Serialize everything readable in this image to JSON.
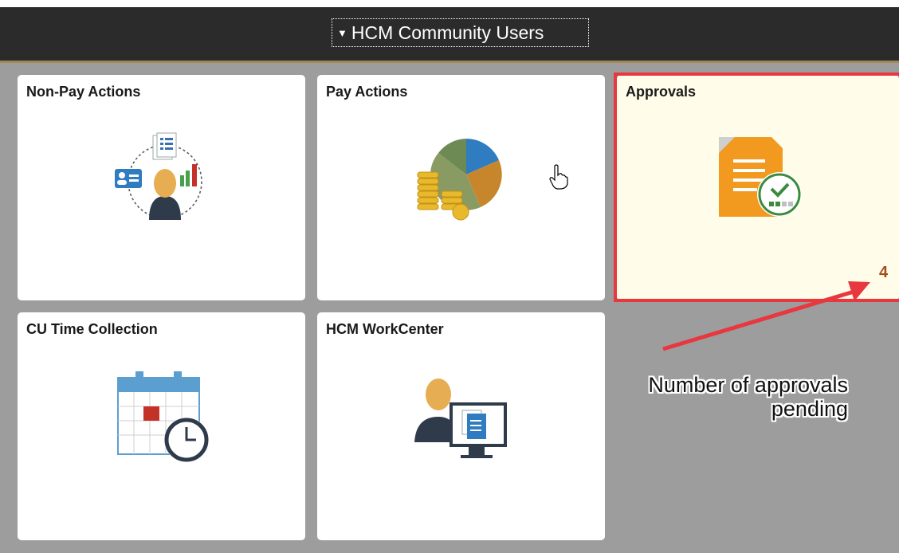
{
  "header": {
    "title": "HCM Community Users",
    "caret_icon": "triangle-down"
  },
  "tiles": [
    {
      "title": "Non-Pay Actions",
      "icon": "employee-actions-icon"
    },
    {
      "title": "Pay Actions",
      "icon": "pie-chart-coins-icon"
    },
    {
      "title": "Approvals",
      "icon": "approval-document-icon",
      "badge": "4"
    },
    {
      "title": "CU Time Collection",
      "icon": "calendar-clock-icon"
    },
    {
      "title": "HCM WorkCenter",
      "icon": "person-monitor-icon"
    }
  ],
  "annotation": {
    "line1": "Number of approvals",
    "line2": "pending",
    "color": "#e8383f"
  },
  "colors": {
    "header_bg": "#2b2b2b",
    "header_accent": "#a08a55",
    "page_bg": "#9d9d9d",
    "approvals_bg": "#fffdea",
    "badge": "#a24d1c"
  }
}
